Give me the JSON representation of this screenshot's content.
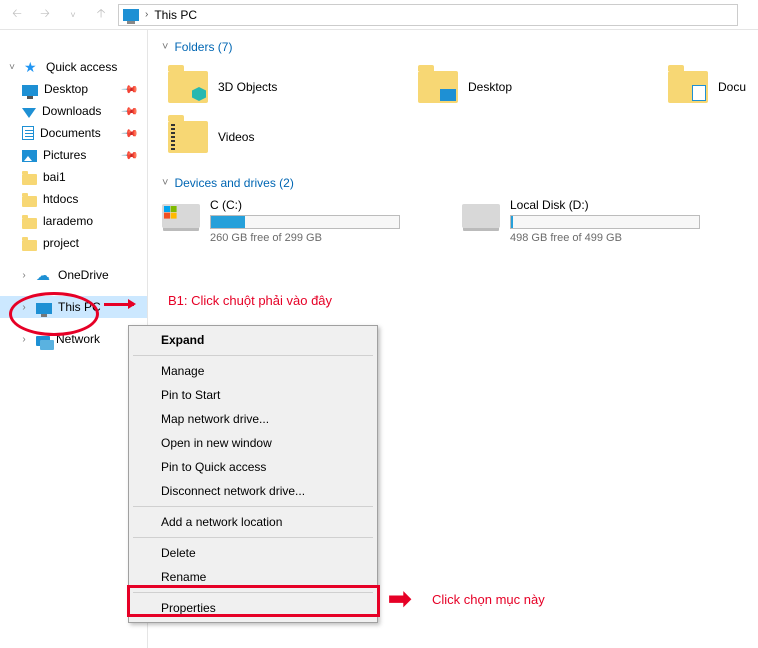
{
  "address": {
    "location": "This PC"
  },
  "sidebar": {
    "quick_access": "Quick access",
    "pinned": [
      {
        "label": "Desktop"
      },
      {
        "label": "Downloads"
      },
      {
        "label": "Documents"
      },
      {
        "label": "Pictures"
      }
    ],
    "recent": [
      {
        "label": "bai1"
      },
      {
        "label": "htdocs"
      },
      {
        "label": "larademo"
      },
      {
        "label": "project"
      }
    ],
    "onedrive": "OneDrive",
    "this_pc": "This PC",
    "network": "Network"
  },
  "sections": {
    "folders_title": "Folders (7)",
    "drives_title": "Devices and drives (2)"
  },
  "folders": [
    {
      "label": "3D Objects"
    },
    {
      "label": "Desktop"
    },
    {
      "label": "Docu"
    },
    {
      "label": "Videos"
    }
  ],
  "drives": [
    {
      "label": "C (C:)",
      "free": "260 GB free of 299 GB",
      "fill_pct": 18
    },
    {
      "label": "Local Disk (D:)",
      "free": "498 GB free of 499 GB",
      "fill_pct": 1
    }
  ],
  "context_menu": {
    "expand": "Expand",
    "manage": "Manage",
    "pin_start": "Pin to Start",
    "map_drive": "Map network drive...",
    "open_new": "Open in new window",
    "pin_qa": "Pin to Quick access",
    "disconnect": "Disconnect network drive...",
    "add_loc": "Add a network location",
    "delete": "Delete",
    "rename": "Rename",
    "properties": "Properties"
  },
  "annotations": {
    "b1": "B1: Click chuột phải vào đây",
    "b2": "Click chọn mục này"
  }
}
